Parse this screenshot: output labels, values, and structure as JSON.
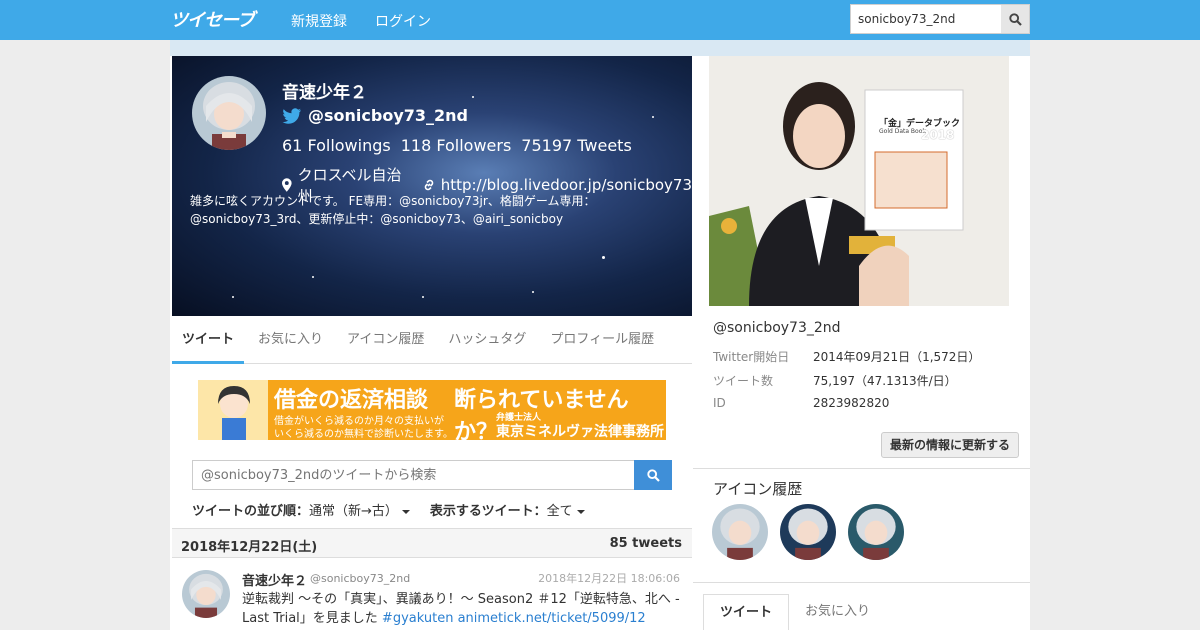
{
  "nav": {
    "logo": "ツイセーブ",
    "register": "新規登録",
    "login": "ログイン",
    "search_value": "sonicboy73_2nd"
  },
  "profile": {
    "name": "音速少年２",
    "handle": "@sonicboy73_2nd",
    "followings": "61 Followings",
    "followers": "118 Followers",
    "tweets": "75197 Tweets",
    "location": "クロスベル自治州",
    "url": "http://blog.livedoor.jp/sonicboy73",
    "bio": "雑多に呟くアカウントです。 FE専用：@sonicboy73jr、格闘ゲーム専用：@sonicboy73_3rd、更新停止中：@sonicboy73、@airi_sonicboy"
  },
  "tabs": [
    "ツイート",
    "お気に入り",
    "アイコン履歴",
    "ハッシュタグ",
    "プロフィール履歴"
  ],
  "ad_banner": {
    "headline": "借金の返済相談",
    "headline2": "断られていませんか？",
    "sub1": "借金がいくら減るのか月々の支払いが",
    "sub2": "いくら減るのか無料で診断いたします。",
    "firm_small": "弁護士法人",
    "firm": "東京ミネルヴァ法律事務所"
  },
  "tweet_search": {
    "placeholder": "@sonicboy73_2ndのツイートから検索"
  },
  "sort": {
    "order_label": "ツイートの並び順：",
    "order_value": "通常（新→古）",
    "display_label": "表示するツイート：",
    "display_value": "全て"
  },
  "date_bar": {
    "date": "2018年12月22日(土)",
    "count": "85 tweets"
  },
  "tweet": {
    "name": "音速少年２",
    "handle": "@sonicboy73_2nd",
    "time": "2018年12月22日 18:06:06",
    "text": "逆転裁判 ～その「真実」、異議あり！～ Season2 ＃12「逆転特急、北へ - Last Trial」を見ました ",
    "hashtag": "#gyakuten",
    "link": "animetick.net/ticket/5099/12"
  },
  "side": {
    "ad_book_title": "「金」データブック",
    "ad_book_sub": "Gold Data Book",
    "ad_book_year": "2018",
    "handle": "@sonicboy73_2nd",
    "rows": [
      {
        "k": "Twitter開始日",
        "v": "2014年09月21日（1,572日）"
      },
      {
        "k": "ツイート数",
        "v": "75,197（47.1313件/日）"
      },
      {
        "k": "ID",
        "v": "2823982820"
      }
    ],
    "update_button": "最新の情報に更新する",
    "icon_history_title": "アイコン履歴",
    "tabs": [
      "ツイート",
      "お気に入り"
    ]
  },
  "colors": {
    "navbar": "#3fa9e8",
    "link": "#2a7fd0",
    "search_button": "#3f8fd8"
  }
}
